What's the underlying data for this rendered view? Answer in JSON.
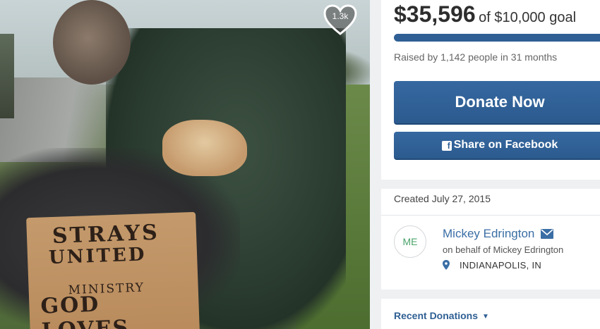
{
  "photo": {
    "likes": "1.3k",
    "sign_line1": "STRAYS",
    "sign_line2": "UNITED",
    "sign_line3": "MINISTRY",
    "sign_line4": "GOD LOVES"
  },
  "campaign": {
    "amount_raised": "$35,596",
    "goal_text": "of $10,000 goal",
    "progress_fraction": 1.0,
    "raised_by": "Raised by 1,142 people in 31 months",
    "donate_label": "Donate Now",
    "share_label": "Share on Facebook",
    "created": "Created July 27, 2015"
  },
  "organizer": {
    "initials": "ME",
    "name": "Mickey Edrington",
    "on_behalf": "on behalf of Mickey Edrington",
    "location": "INDIANAPOLIS, IN"
  },
  "recent_donations": {
    "label": "Recent Donations"
  },
  "colors": {
    "accent": "#2f5f94",
    "link": "#3a6ea5",
    "avatar_text": "#4aa36a"
  },
  "icons": [
    "heart-icon",
    "facebook-icon",
    "mail-icon",
    "map-pin-icon",
    "caret-down-icon"
  ]
}
